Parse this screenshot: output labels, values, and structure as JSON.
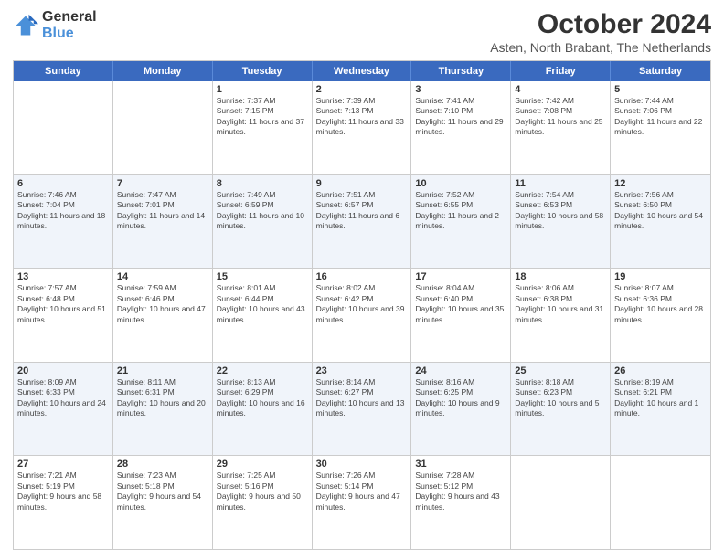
{
  "logo": {
    "line1": "General",
    "line2": "Blue"
  },
  "title": "October 2024",
  "subtitle": "Asten, North Brabant, The Netherlands",
  "header_days": [
    "Sunday",
    "Monday",
    "Tuesday",
    "Wednesday",
    "Thursday",
    "Friday",
    "Saturday"
  ],
  "weeks": [
    [
      {
        "day": "",
        "info": ""
      },
      {
        "day": "",
        "info": ""
      },
      {
        "day": "1",
        "info": "Sunrise: 7:37 AM\nSunset: 7:15 PM\nDaylight: 11 hours and 37 minutes."
      },
      {
        "day": "2",
        "info": "Sunrise: 7:39 AM\nSunset: 7:13 PM\nDaylight: 11 hours and 33 minutes."
      },
      {
        "day": "3",
        "info": "Sunrise: 7:41 AM\nSunset: 7:10 PM\nDaylight: 11 hours and 29 minutes."
      },
      {
        "day": "4",
        "info": "Sunrise: 7:42 AM\nSunset: 7:08 PM\nDaylight: 11 hours and 25 minutes."
      },
      {
        "day": "5",
        "info": "Sunrise: 7:44 AM\nSunset: 7:06 PM\nDaylight: 11 hours and 22 minutes."
      }
    ],
    [
      {
        "day": "6",
        "info": "Sunrise: 7:46 AM\nSunset: 7:04 PM\nDaylight: 11 hours and 18 minutes."
      },
      {
        "day": "7",
        "info": "Sunrise: 7:47 AM\nSunset: 7:01 PM\nDaylight: 11 hours and 14 minutes."
      },
      {
        "day": "8",
        "info": "Sunrise: 7:49 AM\nSunset: 6:59 PM\nDaylight: 11 hours and 10 minutes."
      },
      {
        "day": "9",
        "info": "Sunrise: 7:51 AM\nSunset: 6:57 PM\nDaylight: 11 hours and 6 minutes."
      },
      {
        "day": "10",
        "info": "Sunrise: 7:52 AM\nSunset: 6:55 PM\nDaylight: 11 hours and 2 minutes."
      },
      {
        "day": "11",
        "info": "Sunrise: 7:54 AM\nSunset: 6:53 PM\nDaylight: 10 hours and 58 minutes."
      },
      {
        "day": "12",
        "info": "Sunrise: 7:56 AM\nSunset: 6:50 PM\nDaylight: 10 hours and 54 minutes."
      }
    ],
    [
      {
        "day": "13",
        "info": "Sunrise: 7:57 AM\nSunset: 6:48 PM\nDaylight: 10 hours and 51 minutes."
      },
      {
        "day": "14",
        "info": "Sunrise: 7:59 AM\nSunset: 6:46 PM\nDaylight: 10 hours and 47 minutes."
      },
      {
        "day": "15",
        "info": "Sunrise: 8:01 AM\nSunset: 6:44 PM\nDaylight: 10 hours and 43 minutes."
      },
      {
        "day": "16",
        "info": "Sunrise: 8:02 AM\nSunset: 6:42 PM\nDaylight: 10 hours and 39 minutes."
      },
      {
        "day": "17",
        "info": "Sunrise: 8:04 AM\nSunset: 6:40 PM\nDaylight: 10 hours and 35 minutes."
      },
      {
        "day": "18",
        "info": "Sunrise: 8:06 AM\nSunset: 6:38 PM\nDaylight: 10 hours and 31 minutes."
      },
      {
        "day": "19",
        "info": "Sunrise: 8:07 AM\nSunset: 6:36 PM\nDaylight: 10 hours and 28 minutes."
      }
    ],
    [
      {
        "day": "20",
        "info": "Sunrise: 8:09 AM\nSunset: 6:33 PM\nDaylight: 10 hours and 24 minutes."
      },
      {
        "day": "21",
        "info": "Sunrise: 8:11 AM\nSunset: 6:31 PM\nDaylight: 10 hours and 20 minutes."
      },
      {
        "day": "22",
        "info": "Sunrise: 8:13 AM\nSunset: 6:29 PM\nDaylight: 10 hours and 16 minutes."
      },
      {
        "day": "23",
        "info": "Sunrise: 8:14 AM\nSunset: 6:27 PM\nDaylight: 10 hours and 13 minutes."
      },
      {
        "day": "24",
        "info": "Sunrise: 8:16 AM\nSunset: 6:25 PM\nDaylight: 10 hours and 9 minutes."
      },
      {
        "day": "25",
        "info": "Sunrise: 8:18 AM\nSunset: 6:23 PM\nDaylight: 10 hours and 5 minutes."
      },
      {
        "day": "26",
        "info": "Sunrise: 8:19 AM\nSunset: 6:21 PM\nDaylight: 10 hours and 1 minute."
      }
    ],
    [
      {
        "day": "27",
        "info": "Sunrise: 7:21 AM\nSunset: 5:19 PM\nDaylight: 9 hours and 58 minutes."
      },
      {
        "day": "28",
        "info": "Sunrise: 7:23 AM\nSunset: 5:18 PM\nDaylight: 9 hours and 54 minutes."
      },
      {
        "day": "29",
        "info": "Sunrise: 7:25 AM\nSunset: 5:16 PM\nDaylight: 9 hours and 50 minutes."
      },
      {
        "day": "30",
        "info": "Sunrise: 7:26 AM\nSunset: 5:14 PM\nDaylight: 9 hours and 47 minutes."
      },
      {
        "day": "31",
        "info": "Sunrise: 7:28 AM\nSunset: 5:12 PM\nDaylight: 9 hours and 43 minutes."
      },
      {
        "day": "",
        "info": ""
      },
      {
        "day": "",
        "info": ""
      }
    ]
  ]
}
